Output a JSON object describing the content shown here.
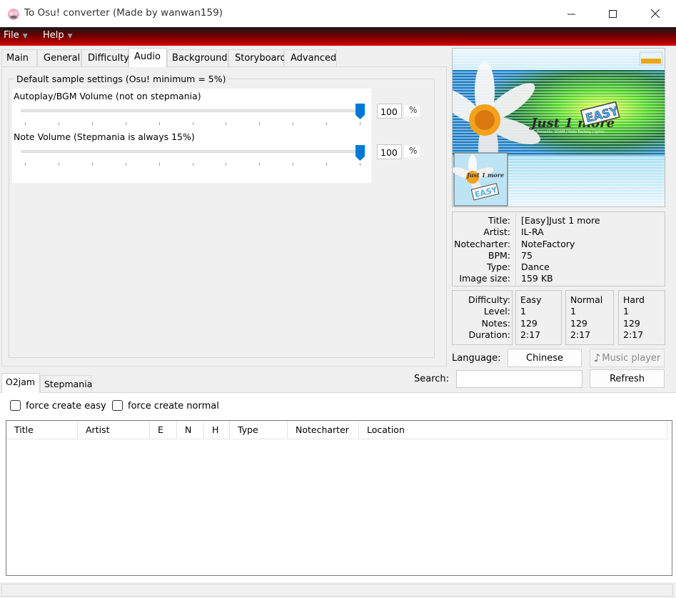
{
  "window": {
    "title": "To Osu! converter (Made by wanwan159)"
  },
  "menu": [
    {
      "label": "File"
    },
    {
      "label": "Help"
    }
  ],
  "tabs": [
    "Main",
    "General",
    "Difficulty",
    "Audio",
    "Background",
    "Storyboard",
    "Advanced"
  ],
  "audio": {
    "group_title": "Default sample settings (Osu! minimum = 5%)",
    "bgm": {
      "label": "Autoplay/BGM Volume (not on stepmania)",
      "value": "100",
      "unit": "%",
      "slider_fraction": 1.0
    },
    "note": {
      "label": "Note Volume (Stepmania is always 15%)",
      "value": "100",
      "unit": "%",
      "slider_fraction": 1.0
    }
  },
  "preview": {
    "logo_text": "Just 1 more",
    "badge": "EASY",
    "small_text": "Presents: SDAM / Note Factory / Lyrics"
  },
  "info": {
    "labels": [
      "Title:",
      "Artist:",
      "Notecharter:",
      "BPM:",
      "Type:",
      "Image size:"
    ],
    "values": [
      "[Easy]Just 1 more",
      "IL-RA",
      "NoteFactory",
      "75",
      "Dance",
      "159 KB"
    ]
  },
  "difficulty": {
    "labels": [
      "Difficulty:",
      "Level:",
      "Notes:",
      "Duration:"
    ],
    "columns": [
      [
        "Easy",
        "1",
        "129",
        "2:17"
      ],
      [
        "Normal",
        "1",
        "129",
        "2:17"
      ],
      [
        "Hard",
        "1",
        "129",
        "2:17"
      ]
    ]
  },
  "language": {
    "label": "Language:",
    "value": "Chinese"
  },
  "music_player": {
    "label": "Music player"
  },
  "search": {
    "label": "Search:",
    "value": ""
  },
  "refresh": {
    "label": "Refresh"
  },
  "bottom_tabs": [
    "O2jam",
    "Stepmania"
  ],
  "checkboxes": {
    "easy": "force create easy",
    "normal": "force create normal"
  },
  "list": {
    "columns": [
      "Title",
      "Artist",
      "E",
      "N",
      "H",
      "Type",
      "Notecharter",
      "Location"
    ]
  },
  "colors": {
    "accent": "#0078d7",
    "menubar_top": "#1a1a1a",
    "menubar_bottom": "#d40000"
  }
}
